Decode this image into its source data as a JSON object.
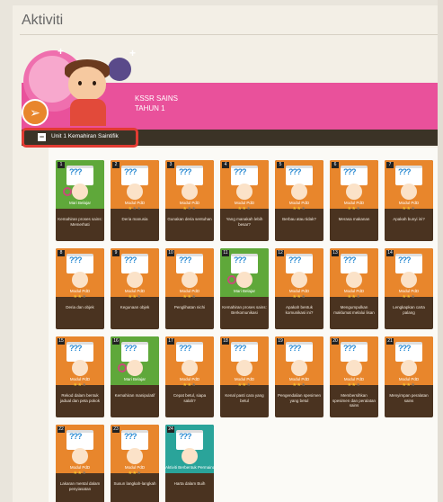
{
  "page": {
    "title": "Aktiviti"
  },
  "banner": {
    "line1": "KSSR SAINS",
    "line2": "TAHUN 1"
  },
  "unit": {
    "toggle": "−",
    "label": "Unit 1 Kemahiran Saintifik"
  },
  "colors": {
    "banner_pink": "#e9519b",
    "unit_bar": "#3b3326",
    "highlight": "#e23b33",
    "card_orange": "#e8862c",
    "card_green": "#5fa83a",
    "card_teal": "#2aa49a"
  },
  "cards": [
    {
      "num": "1",
      "color": "green",
      "type": "Mari Belajar",
      "stars": 0,
      "title": "Kemahiran proses sains: Memerhati"
    },
    {
      "num": "2",
      "color": "orange",
      "type": "Modul PdD",
      "stars": 1,
      "title": "Deria manusia"
    },
    {
      "num": "3",
      "color": "orange",
      "type": "Modul PdD",
      "stars": 1,
      "title": "Gunakan deria sentuhan"
    },
    {
      "num": "4",
      "color": "orange",
      "type": "Modul PdD",
      "stars": 2,
      "title": "Yang manakah lebih besar?"
    },
    {
      "num": "5",
      "color": "orange",
      "type": "Modul PdD",
      "stars": 2,
      "title": "Berbau atau tidak?"
    },
    {
      "num": "6",
      "color": "orange",
      "type": "Modul PdD",
      "stars": 2,
      "title": "Merasa makanan"
    },
    {
      "num": "7",
      "color": "orange",
      "type": "Modul PdD",
      "stars": 2,
      "title": "Apakah bunyi ini?"
    },
    {
      "num": "8",
      "color": "orange",
      "type": "Modul PdD",
      "stars": 2,
      "title": "Deria dan objek"
    },
    {
      "num": "9",
      "color": "orange",
      "type": "Modul PdD",
      "stars": 2,
      "title": "Kegunaan objek"
    },
    {
      "num": "10",
      "color": "orange",
      "type": "Modul PdD",
      "stars": 2,
      "title": "Penglihatan nichi"
    },
    {
      "num": "11",
      "color": "green",
      "type": "Mari Belajar",
      "stars": 0,
      "title": "Kemahiran proses sains: Berkomunikasi"
    },
    {
      "num": "12",
      "color": "orange",
      "type": "Modul PdD",
      "stars": 2,
      "title": "Apakah bentuk komunikasi ini?"
    },
    {
      "num": "13",
      "color": "orange",
      "type": "Modul PdD",
      "stars": 2,
      "title": "Mengumpulkan maklumat melalui lisan"
    },
    {
      "num": "14",
      "color": "orange",
      "type": "Modul PdD",
      "stars": 2,
      "title": "Lengkapkan carta palang"
    },
    {
      "num": "15",
      "color": "orange",
      "type": "Modul PdD",
      "stars": 2,
      "title": "Rekod dalam bentuk jadual dan peta pokok"
    },
    {
      "num": "16",
      "color": "green",
      "type": "Mari Belajar",
      "stars": 0,
      "title": "Kemahiran manipulatif"
    },
    {
      "num": "17",
      "color": "orange",
      "type": "Modul PdD",
      "stars": 2,
      "title": "Cepat betul, siapa salah?"
    },
    {
      "num": "18",
      "color": "orange",
      "type": "Modul PdD",
      "stars": 2,
      "title": "Kenal pasti cara yang betul"
    },
    {
      "num": "19",
      "color": "orange",
      "type": "Modul PdD",
      "stars": 2,
      "title": "Pengendalian spesimen yang betul"
    },
    {
      "num": "20",
      "color": "orange",
      "type": "Modul PdD",
      "stars": 2,
      "title": "Membersihkan spesimen dan peralatan sains"
    },
    {
      "num": "21",
      "color": "orange",
      "type": "Modul PdD",
      "stars": 2,
      "title": "Menyimpan peralatan sains"
    },
    {
      "num": "22",
      "color": "orange",
      "type": "Modul PdD",
      "stars": 2,
      "title": "Lakaran mental dalam penyiasatan"
    },
    {
      "num": "23",
      "color": "orange",
      "type": "Modul PdD",
      "stars": 2,
      "title": "Susun langkah-langkah"
    },
    {
      "num": "24",
      "color": "teal",
      "type": "Aktiviti Berbentuk Permainan",
      "stars": 0,
      "title": "Harta dalam Buih"
    }
  ]
}
